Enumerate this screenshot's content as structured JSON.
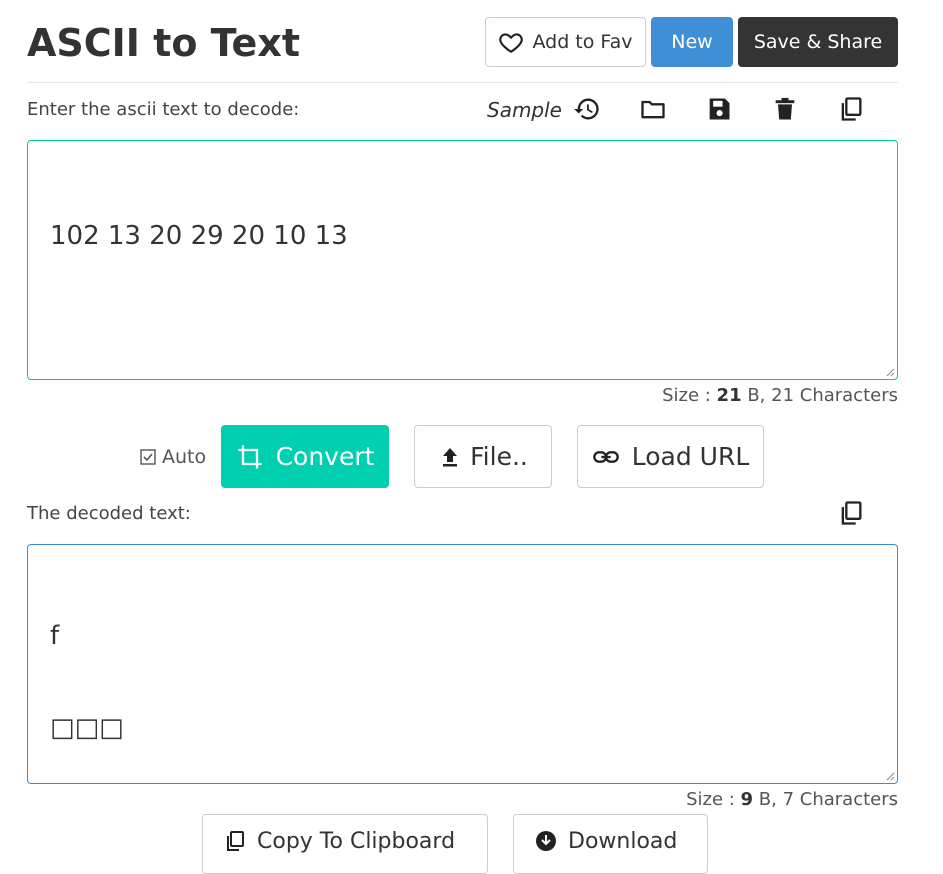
{
  "header": {
    "title": "ASCII to Text",
    "fav_label": "Add to Fav",
    "new_label": "New",
    "save_label": "Save & Share"
  },
  "input": {
    "label": "Enter the ascii text to decode:",
    "sample_label": "Sample",
    "value": "102 13 20 29 20 10 13",
    "size_prefix": "Size : ",
    "size_bytes": "21",
    "size_suffix": " B, 21 Characters"
  },
  "actions": {
    "auto_label": "Auto",
    "convert_label": "Convert",
    "file_label": "File..",
    "url_label": "Load URL"
  },
  "output": {
    "label": "The decoded text:",
    "line1": "f",
    "line2": "□□□",
    "size_prefix": "Size : ",
    "size_bytes": "9",
    "size_suffix": " B, 7 Characters"
  },
  "footer": {
    "clipboard_label": "Copy To Clipboard",
    "download_label": "Download"
  },
  "colors": {
    "new_bg": "#3f8fd6",
    "save_bg": "#343434",
    "convert_bg": "#00cfb0",
    "input_border": "#00c9a7",
    "output_border": "#3a8fcf"
  }
}
